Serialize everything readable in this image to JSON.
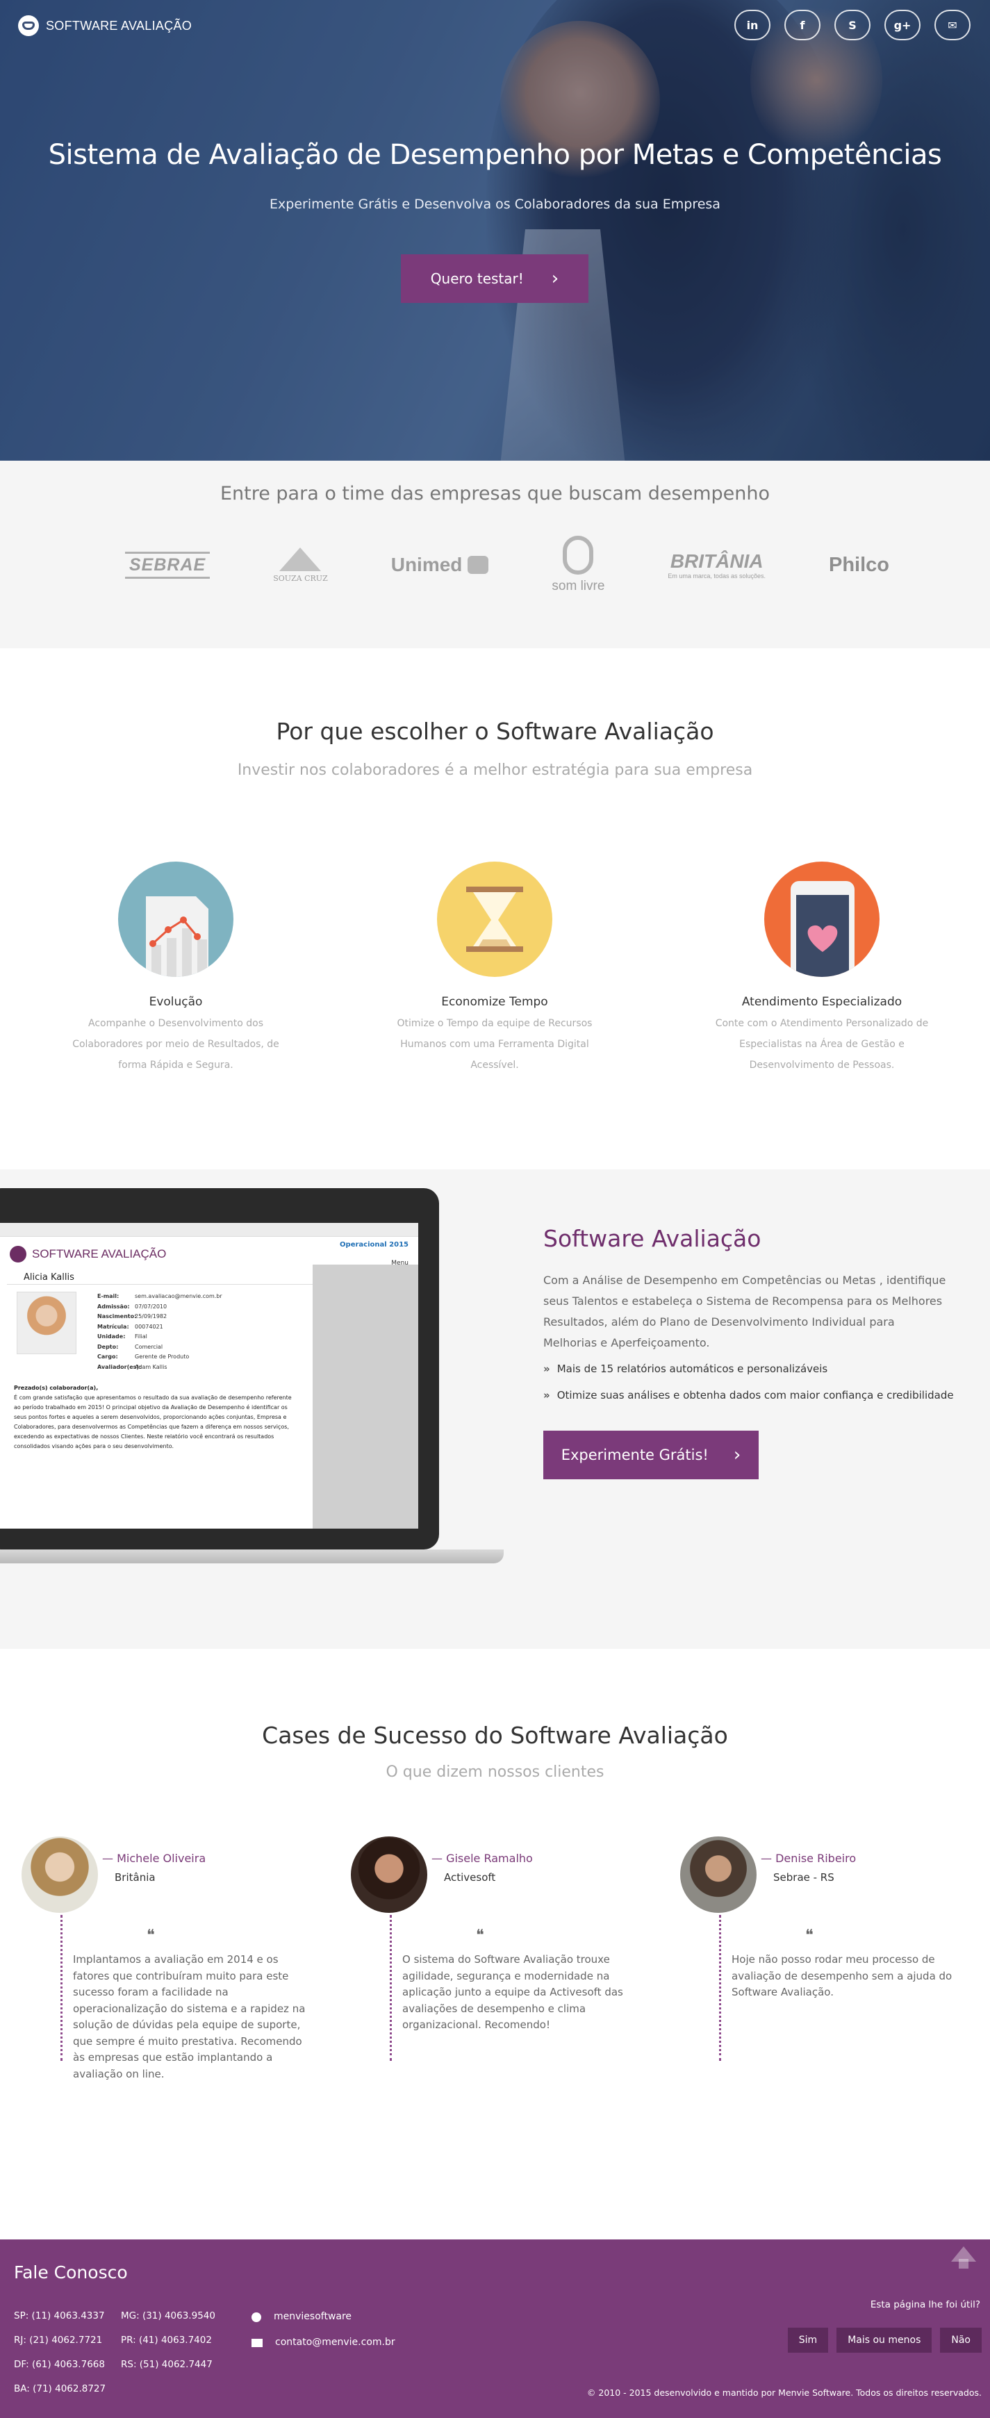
{
  "brand": {
    "name": "SOFTWARE AVALIAÇÃO"
  },
  "social": [
    {
      "icon": "linkedin-icon",
      "glyph": "in"
    },
    {
      "icon": "facebook-icon",
      "glyph": "f"
    },
    {
      "icon": "skype-icon",
      "glyph": "S"
    },
    {
      "icon": "google-plus-icon",
      "glyph": "g+"
    },
    {
      "icon": "email-icon",
      "glyph": "✉"
    }
  ],
  "hero": {
    "title": "Sistema de Avaliação de Desempenho por Metas e Competências",
    "subtitle": "Experimente Grátis e Desenvolva os Colaboradores da sua Empresa",
    "cta": "Quero testar!",
    "cta_arrow": "›"
  },
  "clients": {
    "title": "Entre para o time das empresas que buscam desempenho",
    "logos": [
      "SEBRAE",
      "SOUZA CRUZ",
      "Unimed",
      "som livre",
      "BRITÂNIA",
      "Philco"
    ],
    "britania_tag": "Em uma marca, todas as soluções."
  },
  "why": {
    "title": "Por que escolher o Software Avaliação",
    "subtitle": "Investir nos colaboradores é a melhor estratégia para sua empresa",
    "features": [
      {
        "title": "Evolução",
        "text": "Acompanhe o Desenvolvimento dos Colaboradores por meio de Resultados, de forma Rápida e Segura.",
        "color": "#7fb3c1"
      },
      {
        "title": "Economize Tempo",
        "text": "Otimize o Tempo da equipe de Recursos Humanos com uma Ferramenta Digital Acessível.",
        "color": "#f6d36b"
      },
      {
        "title": "Atendimento Especializado",
        "text": "Conte com o Atendimento Personalizado de Especialistas na Área de Gestão e Desenvolvimento de Pessoas.",
        "color": "#ef6c38"
      }
    ]
  },
  "product": {
    "title": "Software Avaliação",
    "description": "Com a Análise de Desempenho em Competências ou Metas , identifique seus Talentos e estabeleça o Sistema de Recompensa para os Melhores Resultados, além do Plano de Desenvolvimento Individual para Melhorias e Aperfeiçoamento.",
    "bullets": [
      "Mais de 15 relatórios automáticos e personalizáveis",
      "Otimize suas análises e obtenha dados com maior confiança e credibilidade"
    ],
    "bullet_mark": "»",
    "cta": "Experimente Grátis!",
    "cta_arrow": "›",
    "screen": {
      "logo": "SOFTWARE AVALIAÇÃO",
      "badge": "Operacional 2015",
      "menu": "Menu",
      "person": "Alicia Kallis",
      "fields": [
        {
          "k": "E-mail:",
          "v": "sem.avaliacao@menvie.com.br"
        },
        {
          "k": "Admissão:",
          "v": "07/07/2010"
        },
        {
          "k": "Nascimento:",
          "v": "25/09/1982"
        },
        {
          "k": "Matrícula:",
          "v": "00074021"
        },
        {
          "k": "Unidade:",
          "v": "Filial"
        },
        {
          "k": "Depto:",
          "v": "Comercial"
        },
        {
          "k": "Cargo:",
          "v": "Gerente de Produto"
        },
        {
          "k": "Avaliador(es):",
          "v": "Adam Kallis"
        }
      ],
      "text_title": "Prezado(s) colaborador(a),",
      "text": "É com grande satisfação que apresentamos o resultado da sua avaliação de desempenho referente ao período trabalhado em 2015! O principal objetivo da Avaliação de Desempenho é identificar os seus pontos fortes e aqueles a serem desenvolvidos, proporcionando ações conjuntas, Empresa e Colaboradores, para desenvolvermos as Competências que fazem a diferença em nossos serviços, excedendo as expectativas de nossos Clientes. Neste relatório você encontrará os resultados consolidados visando ações para o seu desenvolvimento."
    }
  },
  "cases": {
    "title": "Cases de Sucesso do Software Avaliação",
    "subtitle": "O que dizem nossos clientes",
    "quote_mark": "❝",
    "items": [
      {
        "name": "— Michele Oliveira",
        "company": "Britânia",
        "text": "Implantamos a avaliação em 2014 e os fatores que contribuíram muito para este sucesso foram a facilidade na operacionalização do sistema e a rapidez na solução de dúvidas pela equipe de suporte, que sempre é muito prestativa. Recomendo às empresas que estão implantando a avaliação on line."
      },
      {
        "name": "— Gisele Ramalho",
        "company": "Activesoft",
        "text": "O sistema do Software Avaliação trouxe agilidade, segurança e modernidade na aplicação junto a equipe da Activesoft das avaliações de desempenho e clima organizacional. Recomendo!"
      },
      {
        "name": "— Denise Ribeiro",
        "company": "Sebrae - RS",
        "text": "Hoje não posso rodar meu processo de avaliação de desempenho sem a ajuda do Software Avaliação."
      }
    ]
  },
  "footer": {
    "title": "Fale Conosco",
    "phones_left": [
      "SP: (11) 4063.4337",
      "RJ: (21) 4062.7721",
      "DF: (61) 4063.7668",
      "BA: (71) 4062.8727"
    ],
    "phones_right": [
      "MG: (31) 4063.9540",
      "PR: (41) 4063.7402",
      "RS: (51) 4062.7447"
    ],
    "skype": "menviesoftware",
    "email": "contato@menvie.com.br",
    "useful": "Esta página lhe foi útil?",
    "btn_yes": "Sim",
    "btn_more": "Mais ou menos",
    "btn_no": "Não",
    "copyright": "© 2010 - 2015 desenvolvido e mantido por Menvie Software. Todos os direitos reservados."
  }
}
